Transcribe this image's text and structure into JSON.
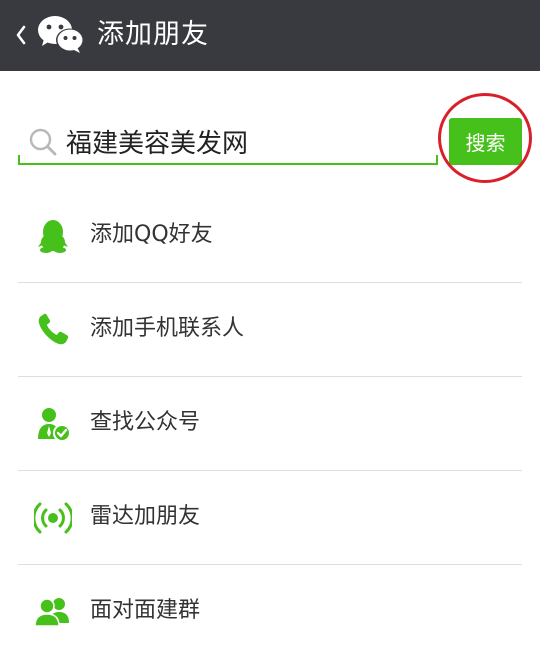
{
  "header": {
    "title": "添加朋友",
    "back_icon": "back-chevron-icon",
    "logo_icon": "wechat-logo-icon",
    "background": "#393a3f"
  },
  "search": {
    "value": "福建美容美发网",
    "button_label": "搜索",
    "icon": "search-icon",
    "accent": "#46c01b",
    "highlight_color": "#d9202a"
  },
  "menu": {
    "items": [
      {
        "label": "添加QQ好友",
        "icon": "qq-penguin-icon"
      },
      {
        "label": "添加手机联系人",
        "icon": "phone-icon"
      },
      {
        "label": "查找公众号",
        "icon": "official-account-icon"
      },
      {
        "label": "雷达加朋友",
        "icon": "radar-icon"
      },
      {
        "label": "面对面建群",
        "icon": "group-icon"
      }
    ],
    "icon_color": "#46c01b"
  }
}
